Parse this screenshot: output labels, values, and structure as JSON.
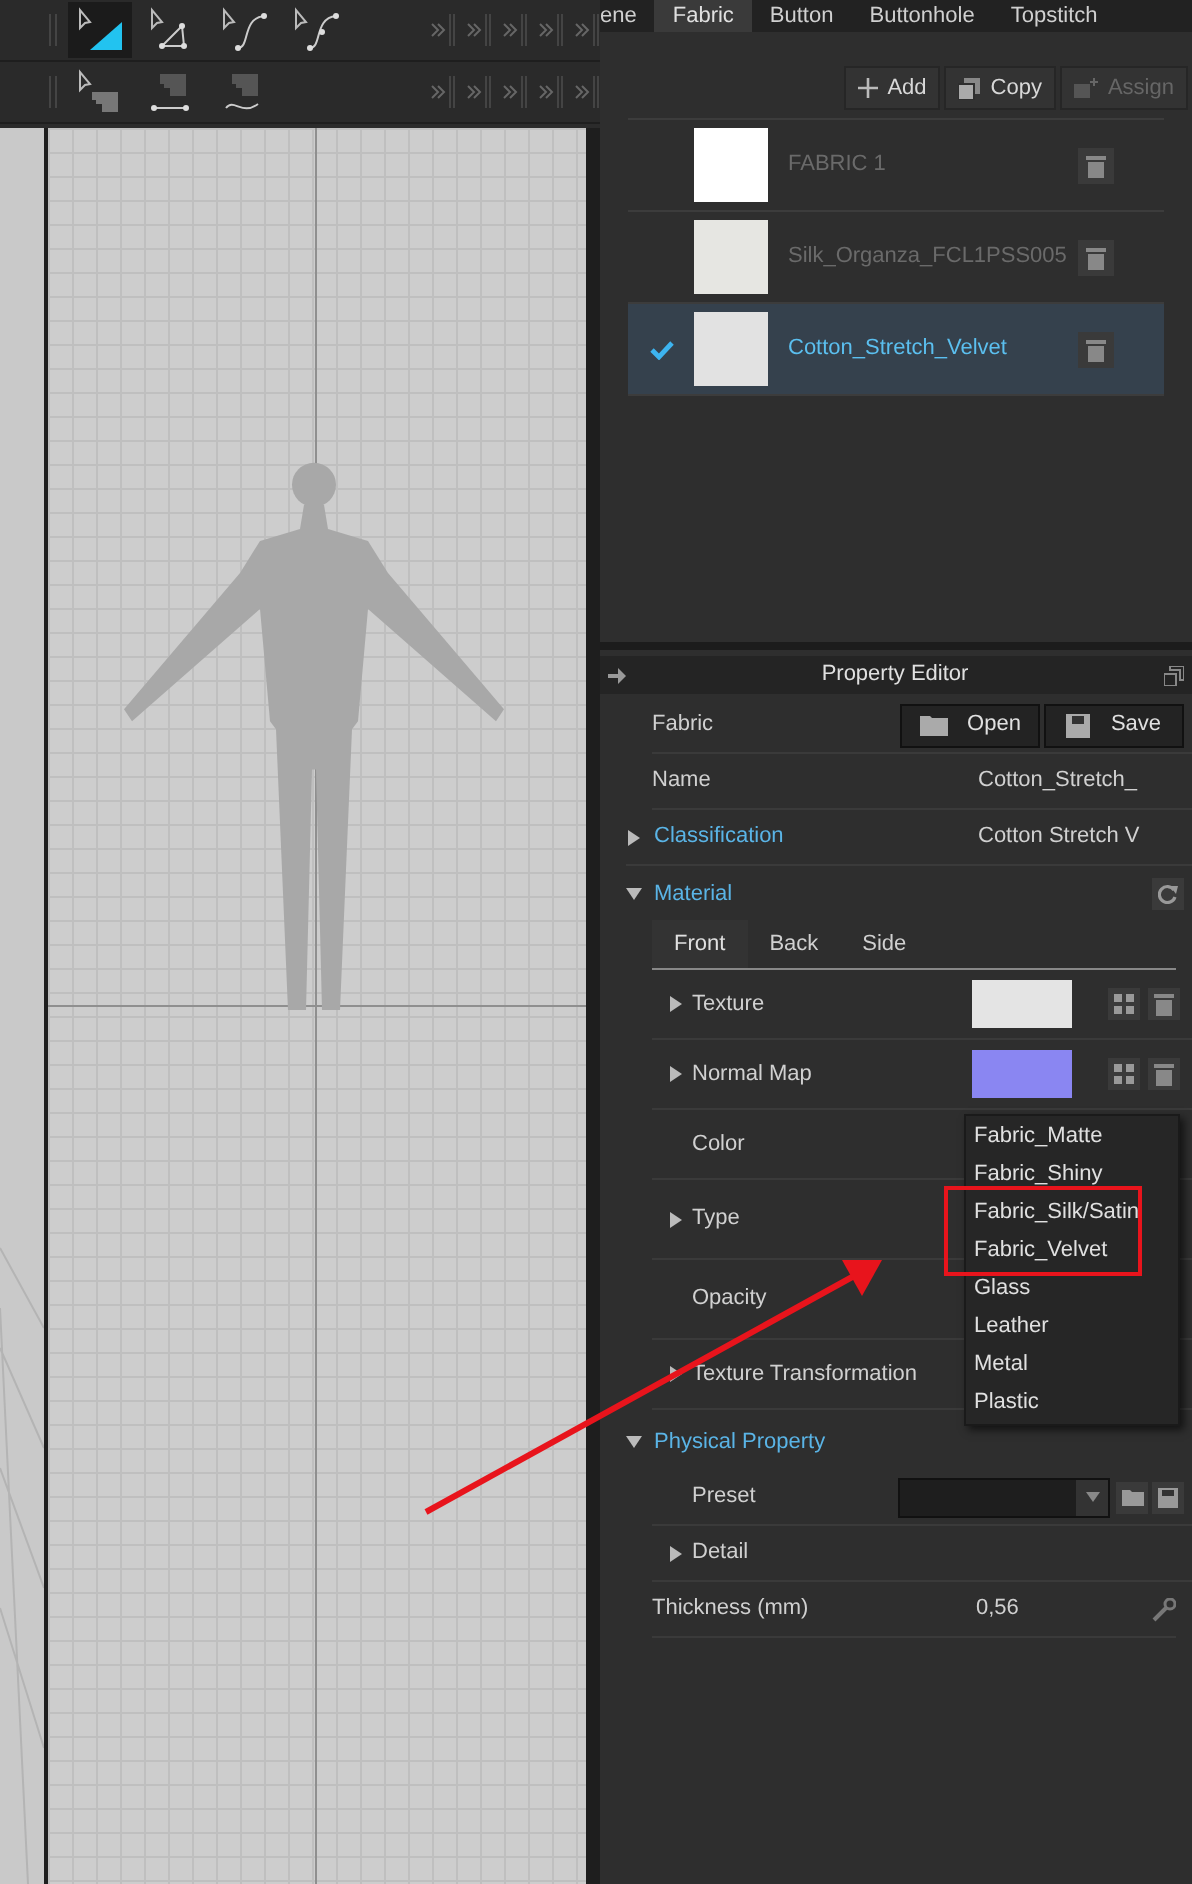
{
  "toolbar_1": [
    {
      "kind": "triangle",
      "selected": true
    },
    {
      "kind": "polygon",
      "selected": false
    },
    {
      "kind": "curve",
      "selected": false
    },
    {
      "kind": "curve-point",
      "selected": false
    }
  ],
  "toolbar_2": [
    {
      "kind": "sew",
      "selected": false
    },
    {
      "kind": "sew-segment",
      "selected": false
    },
    {
      "kind": "sew-free",
      "selected": false
    }
  ],
  "tabs": [
    {
      "label": "ene",
      "selected": false
    },
    {
      "label": "Fabric",
      "selected": true
    },
    {
      "label": "Button",
      "selected": false
    },
    {
      "label": "Buttonhole",
      "selected": false
    },
    {
      "label": "Topstitch",
      "selected": false
    }
  ],
  "fabric_actions": [
    {
      "kind": "add",
      "label": "Add",
      "disabled": false
    },
    {
      "kind": "copy",
      "label": "Copy",
      "disabled": false
    },
    {
      "kind": "assign",
      "label": "Assign",
      "disabled": true
    }
  ],
  "fabrics": [
    {
      "name": "FABRIC 1",
      "color": "#ffffff",
      "selected": false
    },
    {
      "name": "Silk_Organza_FCL1PSS005",
      "color": "#e6e6e2",
      "selected": false
    },
    {
      "name": "Cotton_Stretch_Velvet",
      "color": "#e2e2e2",
      "selected": true
    }
  ],
  "property_editor": {
    "title": "Property Editor",
    "rows": [
      {
        "kind": "file",
        "label": "Fabric",
        "buttons": [
          {
            "kind": "open",
            "label": "Open"
          },
          {
            "kind": "save",
            "label": "Save"
          }
        ]
      },
      {
        "kind": "value",
        "label": "Name",
        "value": "Cotton_Stretch_"
      },
      {
        "kind": "section",
        "label": "Classification",
        "expanded": false,
        "value": "Cotton Stretch V"
      }
    ],
    "material": {
      "label": "Material",
      "expanded": true,
      "tabs": [
        {
          "label": "Front",
          "selected": true
        },
        {
          "label": "Back",
          "selected": false
        },
        {
          "label": "Side",
          "selected": false
        }
      ],
      "rows": [
        {
          "kind": "texture",
          "label": "Texture",
          "expandable": true,
          "color": "#e4e4e4"
        },
        {
          "kind": "texture",
          "label": "Normal Map",
          "expandable": true,
          "color": "#8a86f2"
        },
        {
          "kind": "plain",
          "label": "Color",
          "expandable": false
        },
        {
          "kind": "plain",
          "label": "Type",
          "expandable": true
        },
        {
          "kind": "plain",
          "label": "Opacity",
          "expandable": false
        },
        {
          "kind": "plain",
          "label": "Texture Transformation",
          "expandable": true
        }
      ]
    },
    "physical": {
      "label": "Physical Property",
      "expanded": true,
      "rows": [
        {
          "kind": "preset",
          "label": "Preset"
        },
        {
          "kind": "plain",
          "label": "Detail",
          "expandable": true
        },
        {
          "kind": "thickness",
          "label": "Thickness (mm)",
          "value": "0,56"
        }
      ]
    }
  },
  "type_menu": [
    {
      "label": "Fabric_Matte",
      "selected": false
    },
    {
      "label": "Fabric_Shiny",
      "selected": false
    },
    {
      "label": "Fabric_Silk/Satin",
      "selected": false
    },
    {
      "label": "Fabric_Velvet",
      "selected": false
    },
    {
      "label": "Glass",
      "selected": false
    },
    {
      "label": "Leather",
      "selected": false
    },
    {
      "label": "Metal",
      "selected": false
    },
    {
      "label": "Plastic",
      "selected": false
    }
  ]
}
